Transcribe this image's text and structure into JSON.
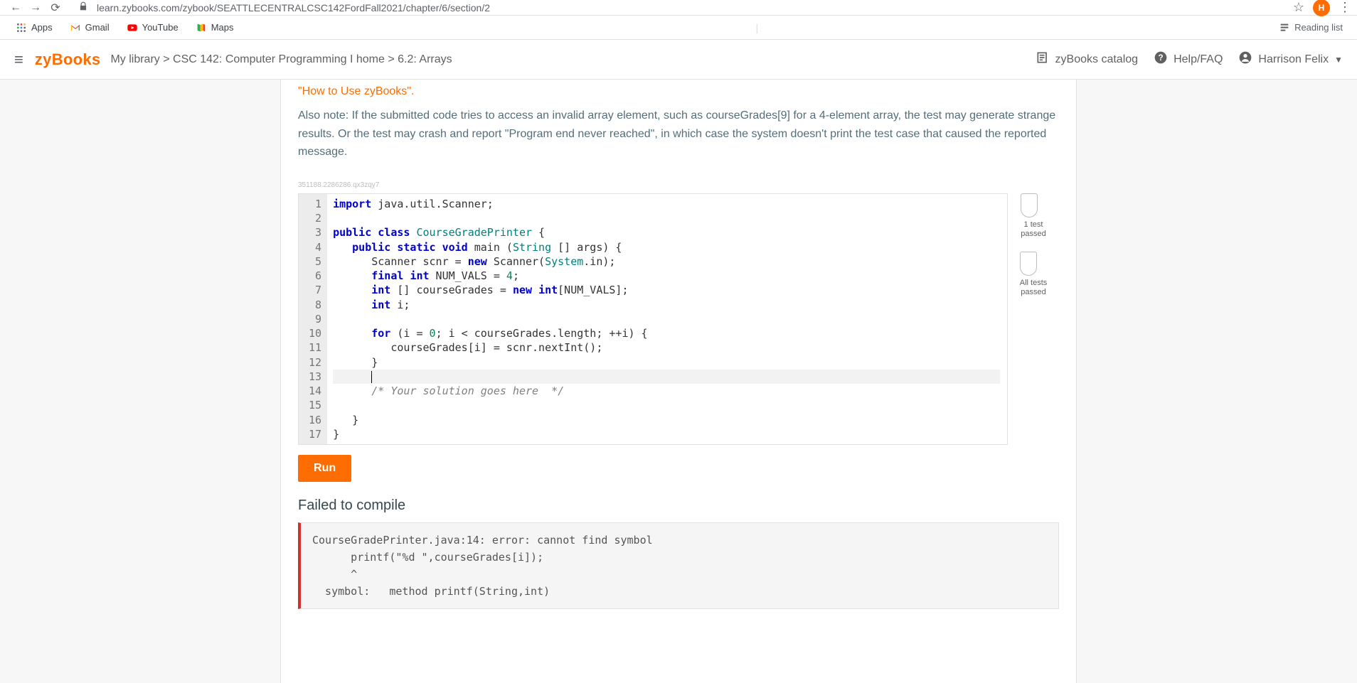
{
  "chrome": {
    "back": "←",
    "forward": "→",
    "reload": "⟳",
    "url": "learn.zybooks.com/zybook/SEATTLECENTRALCSC142FordFall2021/chapter/6/section/2",
    "avatar_letter": "H",
    "reading_list": "Reading list",
    "bookmarks": [
      {
        "label": "Apps"
      },
      {
        "label": "Gmail"
      },
      {
        "label": "YouTube"
      },
      {
        "label": "Maps"
      }
    ]
  },
  "header": {
    "menu": "≡",
    "logo_pre": "zy",
    "logo_post": "Books",
    "breadcrumb": "My library > CSC 142: Computer Programming I home > 6.2: Arrays",
    "catalog": "zyBooks catalog",
    "help": "Help/FAQ",
    "user": "Harrison Felix"
  },
  "content": {
    "howto": "\"How to Use zyBooks\".",
    "note": "Also note: If the submitted code tries to access an invalid array element, such as courseGrades[9] for a 4-element array, the test may generate strange results. Or the test may crash and report \"Program end never reached\", in which case the system doesn't print the test case that caused the reported message.",
    "mini_id": "351188.2286286.qx3zqy7",
    "run_label": "Run",
    "fail_heading": "Failed to compile",
    "error_text": "CourseGradePrinter.java:14: error: cannot find symbol\n      printf(\"%d \",courseGrades[i]);\n      ^\n  symbol:   method printf(String,int)"
  },
  "badges": {
    "b1": "1 test\npassed",
    "b2": "All tests\npassed"
  },
  "code": [
    [
      [
        "kw",
        "import"
      ],
      [
        "",
        " java.util.Scanner;"
      ]
    ],
    [],
    [
      [
        "kw",
        "public"
      ],
      [
        "",
        " "
      ],
      [
        "kw",
        "class"
      ],
      [
        "",
        " "
      ],
      [
        "cls",
        "CourseGradePrinter"
      ],
      [
        "",
        " {"
      ]
    ],
    [
      [
        "",
        "   "
      ],
      [
        "kw",
        "public"
      ],
      [
        "",
        " "
      ],
      [
        "kw",
        "static"
      ],
      [
        "",
        " "
      ],
      [
        "kw",
        "void"
      ],
      [
        "",
        " main ("
      ],
      [
        "cls",
        "String"
      ],
      [
        "",
        " [] args) {"
      ]
    ],
    [
      [
        "",
        "      Scanner scnr = "
      ],
      [
        "kw",
        "new"
      ],
      [
        "",
        " Scanner("
      ],
      [
        "sys",
        "System"
      ],
      [
        "",
        ".in);"
      ]
    ],
    [
      [
        "",
        "      "
      ],
      [
        "kw",
        "final"
      ],
      [
        "",
        " "
      ],
      [
        "kw",
        "int"
      ],
      [
        "",
        " NUM_VALS = "
      ],
      [
        "num",
        "4"
      ],
      [
        "",
        ";"
      ]
    ],
    [
      [
        "",
        "      "
      ],
      [
        "kw",
        "int"
      ],
      [
        "",
        " [] courseGrades = "
      ],
      [
        "kw",
        "new"
      ],
      [
        "",
        " "
      ],
      [
        "kw",
        "int"
      ],
      [
        "",
        "[NUM_VALS];"
      ]
    ],
    [
      [
        "",
        "      "
      ],
      [
        "kw",
        "int"
      ],
      [
        "",
        " i;"
      ]
    ],
    [],
    [
      [
        "",
        "      "
      ],
      [
        "kw",
        "for"
      ],
      [
        "",
        " (i = "
      ],
      [
        "num",
        "0"
      ],
      [
        "",
        "; i < courseGrades.length; ++i) {"
      ]
    ],
    [
      [
        "",
        "         courseGrades[i] = scnr.nextInt();"
      ]
    ],
    [
      [
        "",
        "      }"
      ]
    ],
    [
      [
        "",
        "      "
      ]
    ],
    [
      [
        "",
        "      "
      ],
      [
        "com",
        "/* Your solution goes here  */"
      ]
    ],
    [],
    [
      [
        "",
        "   }"
      ]
    ],
    [
      [
        "",
        "}"
      ]
    ]
  ]
}
